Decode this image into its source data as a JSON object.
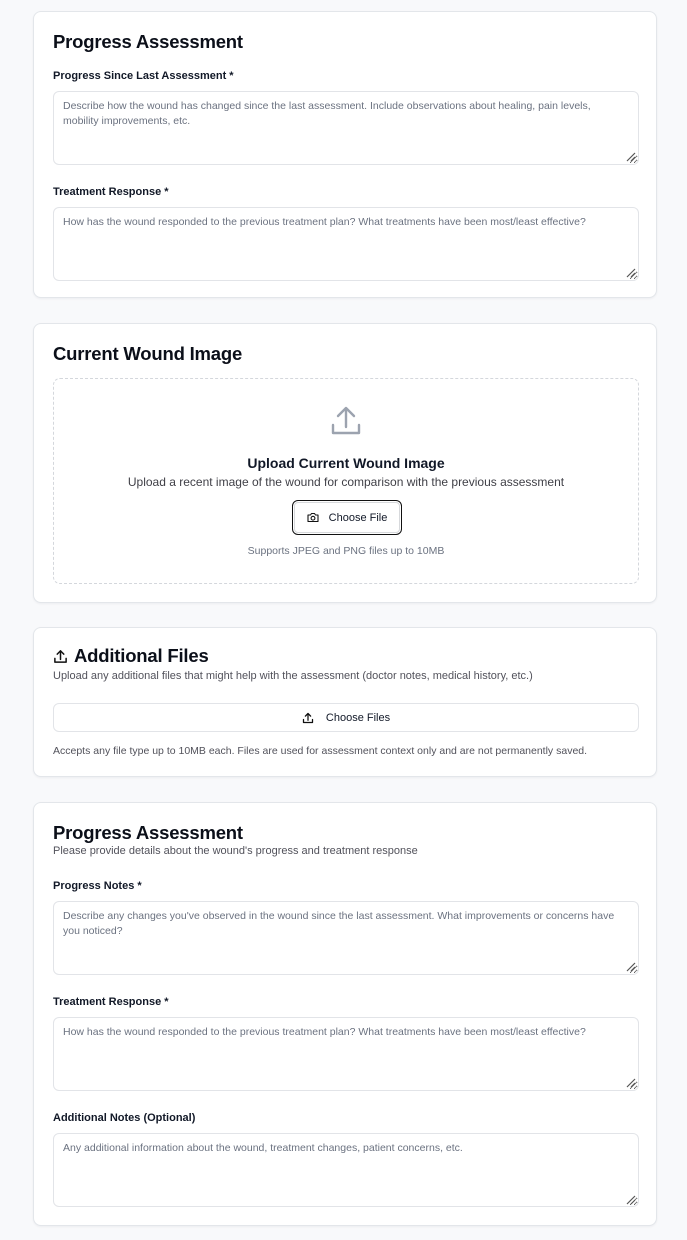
{
  "progress_card": {
    "title": "Progress Assessment",
    "progress_label": "Progress Since Last Assessment *",
    "progress_placeholder": "Describe how the wound has changed since the last assessment. Include observations about healing, pain levels, mobility improvements, etc.",
    "treatment_label": "Treatment Response *",
    "treatment_placeholder": "How has the wound responded to the previous treatment plan? What treatments have been most/least effective?"
  },
  "image_card": {
    "title": "Current Wound Image",
    "upload_icon": "upload-icon",
    "upload_title": "Upload Current Wound Image",
    "upload_description": "Upload a recent image of the wound for comparison with the previous assessment",
    "button_icon": "camera-icon",
    "button_label": "Choose File",
    "hint": "Supports JPEG and PNG files up to 10MB"
  },
  "files_card": {
    "title_icon": "upload-icon",
    "title": "Additional Files",
    "subtitle": "Upload any additional files that might help with the assessment (doctor notes, medical history, etc.)",
    "button_icon": "upload-icon",
    "button_label": "Choose Files",
    "note": "Accepts any file type up to 10MB each. Files are used for assessment context only and are not permanently saved."
  },
  "assessment_card": {
    "title": "Progress Assessment",
    "subtitle": "Please provide details about the wound's progress and treatment response",
    "notes_label": "Progress Notes *",
    "notes_placeholder": "Describe any changes you've observed in the wound since the last assessment. What improvements or concerns have you noticed?",
    "treatment_label": "Treatment Response *",
    "treatment_placeholder": "How has the wound responded to the previous treatment plan? What treatments have been most/least effective?",
    "additional_label": "Additional Notes (Optional)",
    "additional_placeholder": "Any additional information about the wound, treatment changes, patient concerns, etc."
  },
  "colors": {
    "background": "#f8f9fb",
    "card_border": "#e3e6ea",
    "icon_gray": "#9ca3af",
    "text_primary": "#0f172a",
    "text_muted": "#6b7280"
  }
}
